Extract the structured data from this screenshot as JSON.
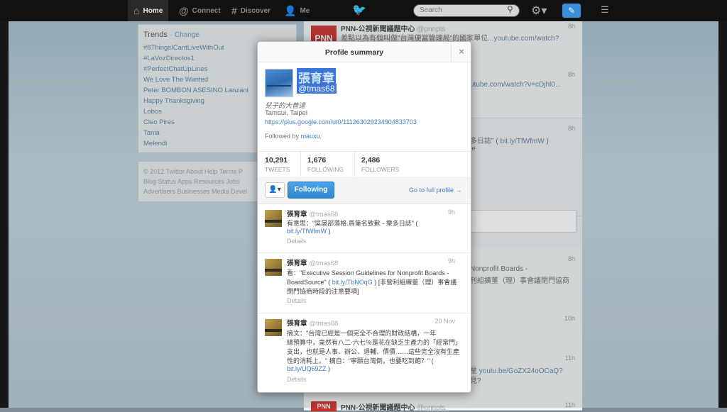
{
  "topbar": {
    "home": "Home",
    "connect": "Connect",
    "discover": "Discover",
    "me": "Me",
    "search_placeholder": "Search"
  },
  "trends": {
    "title": "Trends",
    "change": "· Change",
    "items": [
      "#8ThingsICantLiveWithOut",
      "#LaVozDirectos1",
      "#PerfectChatUpLines",
      "We Love The Wanted",
      "Peter BOMBON ASESINO Lanzani",
      "Happy Thanksgiving",
      "Lobos",
      "Cleo Pires",
      "Tania",
      "Melendi"
    ]
  },
  "footer": {
    "line1": "© 2012 Twitter  About  Help  Terms  P",
    "line2": "Blog  Status  Apps  Resources  Jobs",
    "line3": "Advertisers  Businesses  Media  Devel"
  },
  "timeline": {
    "first_name": "PNN-公視新聞議題中心",
    "first_handle": "@pnnpts",
    "first_time": "8h",
    "first_text": "差點以為有個叫做\"台灣便當管理局\"的國家單位...",
    "first_link": "youtube.com/watch?",
    "second_time": "8h",
    "second_link": "utube.com/watch?v=cDjhl0...",
    "third_time": "8h",
    "third_text": "多日誌\" (",
    "third_link": "bit.ly/TfWfmW",
    "third_close": ")",
    "third_small": "te",
    "fourth_time": "8h",
    "fourth_text": "Nonprofit Boards -",
    "fourth_text2": "刊組擴董（理）事會議閉門協商",
    "fifth_time": "10h",
    "sixth_time": "11h",
    "sixth_text": "星",
    "sixth_link": "youtu.be/GoZX24oOCaQ?",
    "sixth_text2": "見?",
    "last_name": "PNN-公視新聞議題中心",
    "last_handle": "@pnnpts",
    "last_time": "11h",
    "pnn_label": "PNN"
  },
  "modal": {
    "title": "Profile summary",
    "close": "×",
    "name": "張育章",
    "handle": "@tmas68",
    "bio": "兒子的大普達",
    "location": "Tamsui, Taipei",
    "url": "https://plus.google.com/u/0/111263029234904833703",
    "followed_by_label": "Followed by",
    "followed_by_user": "mauxu.",
    "stats": [
      {
        "number": "10,291",
        "label": "TWEETS"
      },
      {
        "number": "1,676",
        "label": "FOLLOWING"
      },
      {
        "number": "2,486",
        "label": "FOLLOWERS"
      }
    ],
    "user_icon": "👤▾",
    "following_label": "Following",
    "go_full": "Go to full profile →"
  },
  "tweets": [
    {
      "name": "張育章",
      "handle": "@tmas68",
      "time": "9h",
      "lines": [
        "有意思：\"吳晟部落格.爲筆名致歉 - 樂多日誌\" (",
        ""
      ],
      "link_line": "bit.ly/TfWfmW",
      "link_suffix": " )",
      "details": "Details"
    },
    {
      "name": "張育章",
      "handle": "@tmas68",
      "time": "9h",
      "line1": "看：\"Executive Session Guidelines for Nonprofit Boards -",
      "line2_pre": "BoardSource\" ( ",
      "line2_link": "bit.ly/TbNOqG",
      "line2_post": " ) [非營利組織董（理）事會議",
      "line3": "閉門協商時段的注意要項]",
      "details": "Details"
    },
    {
      "name": "張育章",
      "handle": "@tmas68",
      "time": "20 Nov",
      "line1": "摘文：\"台灣已經是一個完全不合理的財政結構，一年",
      "line2": "總預算中，竟然有八二·六七％是花在缺乏生產力的「經常門」",
      "line3": "支出，也就是人事、辦公、退輔、債債……這些完全沒有生產",
      "line4": "性的消耗上。\" 摘自：\"寧願台灣倒，也要吃到飽？\" (",
      "link": "bit.ly/UQ69ZZ",
      "link_suffix": " )",
      "details": "Details"
    }
  ]
}
